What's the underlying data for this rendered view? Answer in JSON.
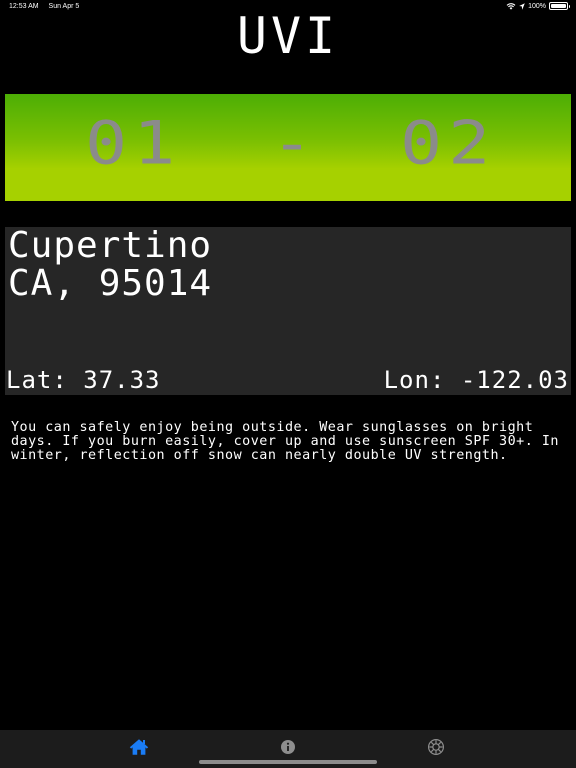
{
  "status_bar": {
    "time": "12:53 AM",
    "date": "Sun Apr 5",
    "battery": "100%"
  },
  "app": {
    "title": "UVI"
  },
  "uvi": {
    "low": "01",
    "separator": "-",
    "high": "02",
    "colors": {
      "gradient_top": "#4cae05",
      "gradient_bottom": "#a6d100",
      "digits": "#8b8b8b"
    }
  },
  "location": {
    "city": "Cupertino",
    "region": "CA, 95014",
    "lat": "Lat: 37.33",
    "lon": "Lon: -122.03",
    "panel_color": "#262626"
  },
  "advice": "You can safely enjoy being outside. Wear sunglasses on bright days. If you burn easily, cover up and use sunscreen SPF 30+. In winter, reflection off snow can nearly double UV strength.",
  "tabs": [
    {
      "icon": "home-icon",
      "selected": true,
      "color": "#1a7cf5"
    },
    {
      "icon": "info-icon",
      "selected": false,
      "color": "#8e8e8e"
    },
    {
      "icon": "gear-icon",
      "selected": false,
      "color": "#8e8e8e"
    }
  ]
}
